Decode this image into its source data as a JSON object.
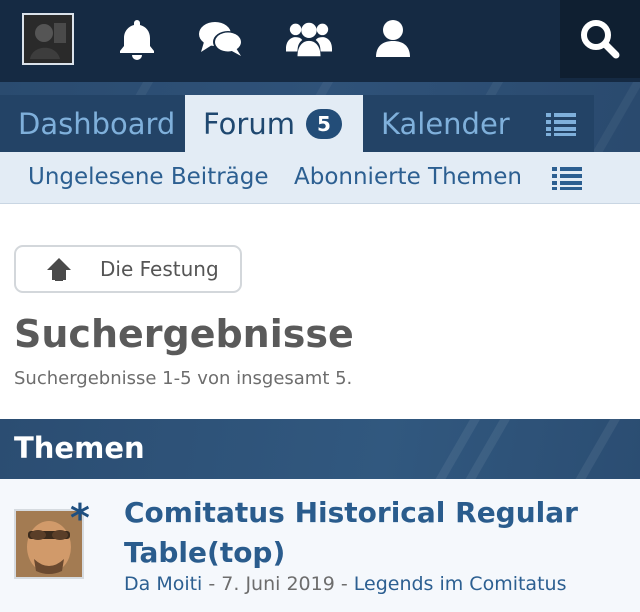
{
  "topbar": {
    "icons": [
      "avatar",
      "bell-icon",
      "chat-bubbles-icon",
      "users-icon",
      "user-icon",
      "search-icon"
    ]
  },
  "main_tabs": [
    {
      "label": "Dashboard",
      "active": false
    },
    {
      "label": "Forum",
      "active": true,
      "badge": "5"
    },
    {
      "label": "Kalender",
      "active": false
    }
  ],
  "sub_nav": {
    "items": [
      "Ungelesene Beiträge",
      "Abonnierte Themen"
    ]
  },
  "breadcrumb": {
    "label": "Die Festung"
  },
  "page": {
    "title": "Suchergebnisse",
    "description": "Suchergebnisse 1-5 von insgesamt 5."
  },
  "section": {
    "title": "Themen"
  },
  "threads": [
    {
      "title": "Comitatus Historical Regular Table(top)",
      "author": "Da Moiti",
      "separator1": " - ",
      "date": "7. Juni 2019",
      "separator2": " - ",
      "board": "Legends im Comitatus",
      "unread_marker": "*"
    }
  ],
  "colors": {
    "topbar_bg": "#152a43",
    "tab_bg": "#2f5279",
    "active_tab_bg": "#e3ecf5",
    "link": "#2c5f91",
    "title_gray": "#5a5a5a"
  }
}
